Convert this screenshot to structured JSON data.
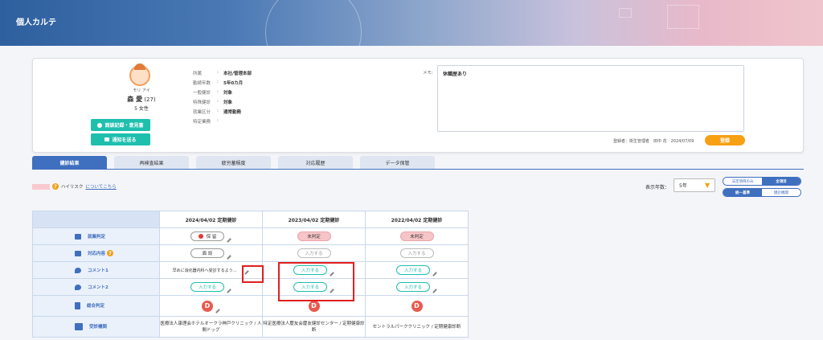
{
  "header": {
    "title": "個人カルテ"
  },
  "profile": {
    "kana": "モリ アイ",
    "name": "森 愛",
    "age": "(27)",
    "gender": "5 女性",
    "btn_interview": "面談記録・意見書",
    "btn_notify": "通知を送る",
    "fields": [
      {
        "label": "所属",
        "sep": ":",
        "value": "本社/管理本部"
      },
      {
        "label": "勤続年数",
        "sep": ":",
        "value": "5年0カ月"
      },
      {
        "label": "一般健診",
        "sep": ":",
        "value": "対象"
      },
      {
        "label": "特殊健診",
        "sep": ":",
        "value": "対象"
      },
      {
        "label": "就業区分",
        "sep": ":",
        "value": "通常勤務"
      },
      {
        "label": "特定業務",
        "sep": ":",
        "value": ""
      }
    ]
  },
  "memo": {
    "label": "メモ:",
    "text": "休職歴あり",
    "registrant": "登録者：衛生管理者　田中 花　2024/07/09",
    "register_btn": "登録"
  },
  "tabs": [
    "健診結果",
    "再検査結果",
    "疲労蓄積度",
    "対応履歴",
    "データ保管"
  ],
  "legend": {
    "text": "ハイリスク",
    "link": "についてこちら"
  },
  "display": {
    "years_label": "表示年数：",
    "years_value": "5年",
    "toggle1": [
      "法定項目のみ",
      "全項目"
    ],
    "toggle2": [
      "統一基準",
      "健診機関"
    ]
  },
  "table": {
    "columns": [
      "2024/04/02 定期健診",
      "2023/04/02 定期健診",
      "2022/04/02 定期健診"
    ],
    "rows": [
      {
        "label": "就業判定",
        "cells": [
          "保 留",
          "未判定",
          "未判定"
        ]
      },
      {
        "label": "対応内容",
        "cells": [
          "面 談",
          "入力する",
          "入力する"
        ]
      },
      {
        "label": "コメント1",
        "cells": [
          "早めに消化器内科へ受診するよう...",
          "入力する",
          "入力する"
        ]
      },
      {
        "label": "コメント2",
        "cells": [
          "入力する",
          "入力する",
          "入力する"
        ]
      },
      {
        "label": "総合判定",
        "cells": [
          "D",
          "D",
          "D"
        ]
      },
      {
        "label": "受診機関",
        "cells": [
          "医療法人康理会ホテルオークラ神戸クリニック / 人間ドッグ",
          "特定医療法人慶友会慶友健診センター / 定期健康診断",
          "セントラルパーククリニック / 定期健康診断"
        ]
      }
    ]
  }
}
